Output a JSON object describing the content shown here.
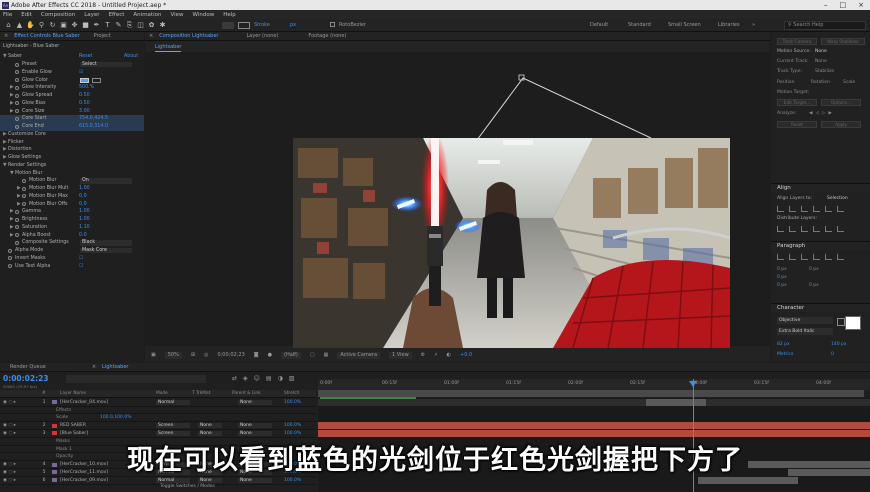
{
  "titlebar": {
    "title": "Adobe After Effects CC 2018 - Untitled Project.aep *",
    "logo": "Ae"
  },
  "menu": [
    "File",
    "Edit",
    "Composition",
    "Layer",
    "Effect",
    "Animation",
    "View",
    "Window",
    "Help"
  ],
  "toolbar": {
    "stroke_label": "Stroke",
    "stroke_size": "px",
    "rotobezier_label": "RotoBezier",
    "workspaces": [
      "Default",
      "Standard",
      "Small Screen",
      "Libraries"
    ],
    "search_placeholder": "Search Help"
  },
  "effect_controls": {
    "tab_label": "Effect Controls Blue Saber",
    "project_tab": "Project",
    "breadcrumb": "Lightsaber - Blue Saber",
    "rows": [
      {
        "label": "Saber",
        "indent": 0,
        "tri": "▼",
        "value": "Reset",
        "about": "About",
        "stopwatch": false
      },
      {
        "label": "Preset",
        "indent": 1,
        "value": "Select",
        "dd": true,
        "stopwatch": true
      },
      {
        "label": "Enable Glow",
        "indent": 1,
        "value": "☑",
        "stopwatch": true
      },
      {
        "label": "Glow Color",
        "indent": 1,
        "value": "",
        "stopwatch": true
      },
      {
        "label": "Glow Intensity",
        "indent": 1,
        "tri": "▶",
        "value": "500.%",
        "stopwatch": true
      },
      {
        "label": "Glow Spread",
        "indent": 1,
        "tri": "▶",
        "value": "0.50",
        "stopwatch": true
      },
      {
        "label": "Glow Bias",
        "indent": 1,
        "tri": "▶",
        "value": "0.50",
        "stopwatch": true
      },
      {
        "label": "Core Size",
        "indent": 1,
        "tri": "▶",
        "value": "3.00",
        "stopwatch": true
      },
      {
        "label": "Core Start",
        "indent": 1,
        "value": "754.0,424.5",
        "stopwatch": true
      },
      {
        "label": "Core End",
        "indent": 1,
        "value": "615.0,314.0",
        "stopwatch": true
      },
      {
        "label": "Customize Core",
        "indent": 0,
        "tri": "▶",
        "value": ""
      },
      {
        "label": "Flicker",
        "indent": 0,
        "tri": "▶",
        "value": ""
      },
      {
        "label": "Distortion",
        "indent": 0,
        "tri": "▶",
        "value": ""
      },
      {
        "label": "Glow Settings",
        "indent": 0,
        "tri": "▶",
        "value": ""
      },
      {
        "label": "Render Settings",
        "indent": 0,
        "tri": "▼",
        "value": ""
      },
      {
        "label": "Motion Blur",
        "indent": 1,
        "tri": "▼",
        "value": ""
      },
      {
        "label": "Motion Blur",
        "indent": 2,
        "value": "On",
        "dd": true,
        "stopwatch": true
      },
      {
        "label": "Motion Blur Mult",
        "indent": 2,
        "tri": "▶",
        "value": "1.00",
        "stopwatch": true
      },
      {
        "label": "Motion Blur Max",
        "indent": 2,
        "tri": "▶",
        "value": "0.0",
        "stopwatch": true
      },
      {
        "label": "Motion Blur Offs",
        "indent": 2,
        "tri": "▶",
        "value": "0.0",
        "stopwatch": true
      },
      {
        "label": "Gamma",
        "indent": 1,
        "tri": "▶",
        "value": "1.00",
        "stopwatch": true
      },
      {
        "label": "Brightness",
        "indent": 1,
        "tri": "▶",
        "value": "1.00",
        "stopwatch": true
      },
      {
        "label": "Saturation",
        "indent": 1,
        "tri": "▶",
        "value": "1.10",
        "stopwatch": true
      },
      {
        "label": "Alpha Boost",
        "indent": 1,
        "tri": "▶",
        "value": "0.0",
        "stopwatch": true
      },
      {
        "label": "Composite Settings",
        "indent": 1,
        "value": "Black",
        "dd": true,
        "stopwatch": true
      },
      {
        "label": "Alpha Mode",
        "indent": 0,
        "value": "Mask Core",
        "dd": true,
        "stopwatch": true
      },
      {
        "label": "Invert Masks",
        "indent": 0,
        "value": "☐",
        "stopwatch": true
      },
      {
        "label": "Use Text Alpha",
        "indent": 0,
        "value": "☐",
        "stopwatch": true
      }
    ]
  },
  "composition": {
    "tab_label": "Composition Lightsaber",
    "layer_tab": "Layer (none)",
    "footage_tab": "Footage (none)",
    "breadcrumb": "Lightsaber"
  },
  "viewer_bar": {
    "zoom": "50%",
    "timecode": "0;00;02;23",
    "resolution": "(Half)",
    "camera": "Active Camera",
    "views": "1 View",
    "exposure": "+0.0"
  },
  "right_panel": {
    "tracker_buttons": [
      "Track Camera",
      "Warp Stabilizer",
      "Track Motion",
      "Stabilize Motion"
    ],
    "motion_source_label": "Motion Source:",
    "motion_source_value": "None",
    "current_track_label": "Current Track:",
    "current_track_value": "None",
    "track_type_label": "Track Type:",
    "track_type_value": "Stabilize",
    "options": [
      "Position",
      "Rotation",
      "Scale"
    ],
    "motion_target_label": "Motion Target:",
    "edit_target": "Edit Target...",
    "options_btn": "Options...",
    "analyze_label": "Analyze:",
    "reset_btn": "Reset",
    "apply_btn": "Apply",
    "align_title": "Align",
    "align_to_label": "Align Layers to:",
    "align_to_value": "Selection",
    "distribute_label": "Distribute Layers:",
    "paragraph_title": "Paragraph",
    "para_values": [
      "0 px",
      "0 px",
      "0 px",
      "0 px",
      "0 px"
    ],
    "character_title": "Character",
    "font_name": "Objective",
    "font_style": "Extra Bold Italic",
    "font_size": "82 px",
    "leading": "140 px",
    "kerning": "Metrics",
    "tracking": "0"
  },
  "timeline": {
    "tabs": [
      "Render Queue",
      "Lightsaber"
    ],
    "timecode": "0:00:02:23",
    "fps_info": "00083 (29.97 fps)",
    "col_headers": [
      "#",
      "Layer Name",
      "Mode",
      "T TrkMat",
      "Parent & Link",
      "Stretch"
    ],
    "ruler": [
      "0:00f",
      "00:15f",
      "01:00f",
      "01:15f",
      "02:00f",
      "02:15f",
      "03:00f",
      "03:15f",
      "04:00f",
      "04:15f"
    ],
    "toggle_label": "Toggle Switches / Modes",
    "layers": [
      {
        "num": "1",
        "name": "[HerCracker_04.mov]",
        "color": "#7a6a9a",
        "mode": "Normal",
        "trkmat": "",
        "parent": "None",
        "stretch": "100.0%"
      },
      {
        "num": "",
        "name": "Effects",
        "color": "",
        "mode": "",
        "trkmat": "",
        "parent": "",
        "stretch": "",
        "sub": true
      },
      {
        "num": "",
        "name": "Scale",
        "color": "",
        "mode": "",
        "trkmat": "",
        "parent": "",
        "stretch": "",
        "sub": true,
        "value": "100.0,100.0%"
      },
      {
        "num": "2",
        "name": "RED SABER",
        "color": "#c83a3a",
        "mode": "Screen",
        "trkmat": "None",
        "parent": "None",
        "stretch": "100.0%"
      },
      {
        "num": "3",
        "name": "[Blue Saber]",
        "color": "#c83a3a",
        "mode": "Screen",
        "trkmat": "None",
        "parent": "None",
        "stretch": "100.0%"
      },
      {
        "num": "",
        "name": "Masks",
        "color": "",
        "mode": "",
        "trkmat": "",
        "parent": "",
        "stretch": "",
        "sub": true
      },
      {
        "num": "",
        "name": "Mask 1",
        "color": "",
        "mode": "",
        "trkmat": "",
        "parent": "",
        "stretch": "",
        "sub": true
      },
      {
        "num": "",
        "name": "Opacity",
        "color": "",
        "mode": "",
        "trkmat": "",
        "parent": "",
        "stretch": "",
        "sub": true
      },
      {
        "num": "4",
        "name": "[HerCracker_10.mov]",
        "color": "#7a6a9a",
        "mode": "Normal",
        "trkmat": "None",
        "parent": "None",
        "stretch": "100.0%"
      },
      {
        "num": "5",
        "name": "[HerCracker_11.mov]",
        "color": "#7a6a9a",
        "mode": "Normal",
        "trkmat": "None",
        "parent": "None",
        "stretch": "100.0%"
      },
      {
        "num": "6",
        "name": "[HerCracker_09.mov]",
        "color": "#7a6a9a",
        "mode": "Normal",
        "trkmat": "None",
        "parent": "None",
        "stretch": "100.0%"
      }
    ],
    "current_frame_fraction": 0.68
  },
  "subtitle": "现在可以看到蓝色的光剑位于红色光剑握把下方了",
  "colors": {
    "accent": "#3d8fe8",
    "bar_red": "#b34a3f",
    "bar_gray": "#5a5a5a",
    "bar_green": "#3c6b3c"
  }
}
